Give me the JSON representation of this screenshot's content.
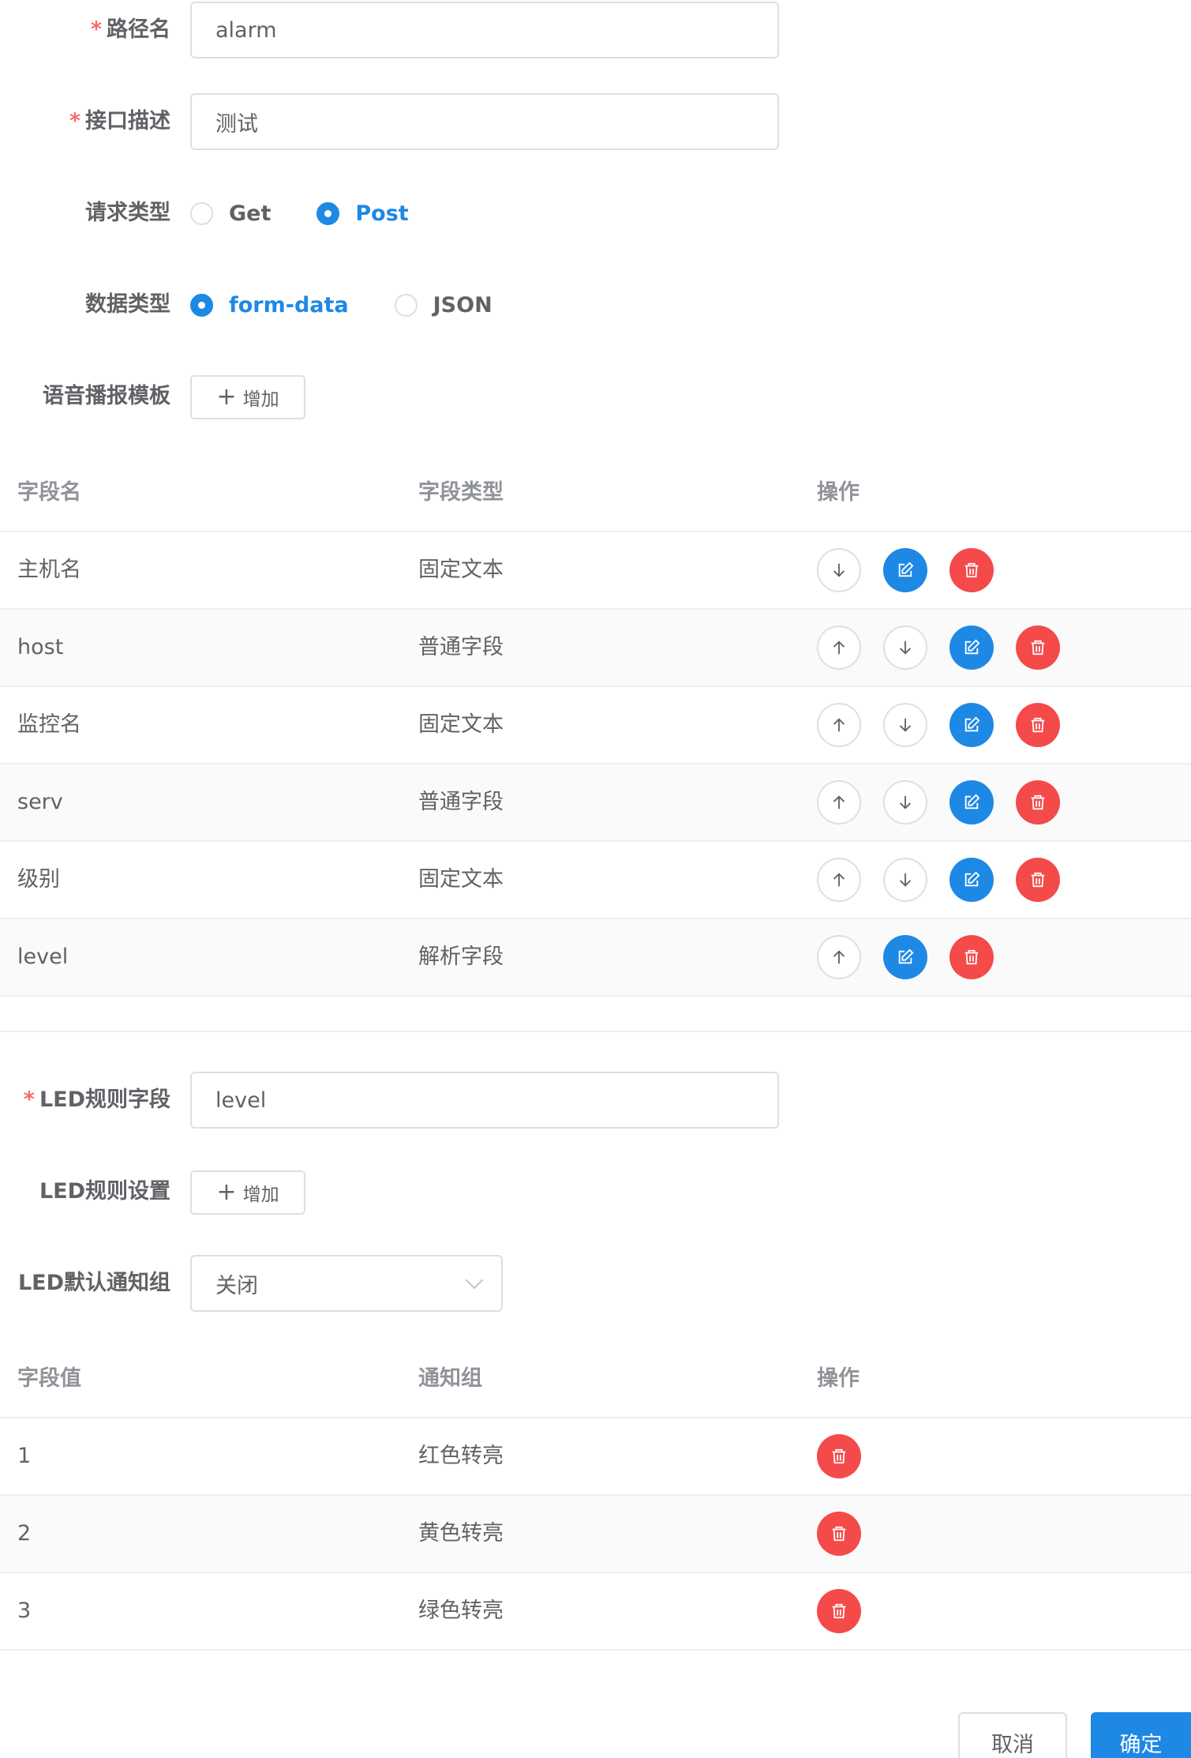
{
  "form": {
    "path_name": {
      "label": "路径名",
      "value": "alarm"
    },
    "interface_desc": {
      "label": "接口描述",
      "value": "测试"
    },
    "request_type": {
      "label": "请求类型",
      "options": [
        "Get",
        "Post"
      ],
      "selected": "Post"
    },
    "data_type": {
      "label": "数据类型",
      "options": [
        "form-data",
        "JSON"
      ],
      "selected": "form-data"
    },
    "voice_template": {
      "label": "语音播报模板",
      "add_label": "增加"
    },
    "led_rule_field": {
      "label": "LED规则字段",
      "value": "level"
    },
    "led_rule_settings": {
      "label": "LED规则设置",
      "add_label": "增加"
    },
    "led_default_group": {
      "label": "LED默认通知组",
      "value": "关闭"
    }
  },
  "fields_table": {
    "headers": [
      "字段名",
      "字段类型",
      "操作"
    ],
    "rows": [
      {
        "name": "主机名",
        "type": "固定文本"
      },
      {
        "name": "host",
        "type": "普通字段"
      },
      {
        "name": "监控名",
        "type": "固定文本"
      },
      {
        "name": "serv",
        "type": "普通字段"
      },
      {
        "name": "级别",
        "type": "固定文本"
      },
      {
        "name": "level",
        "type": "解析字段"
      }
    ]
  },
  "led_table": {
    "headers": [
      "字段值",
      "通知组",
      "操作"
    ],
    "rows": [
      {
        "value": "1",
        "group": "红色转亮"
      },
      {
        "value": "2",
        "group": "黄色转亮"
      },
      {
        "value": "3",
        "group": "绿色转亮"
      }
    ]
  },
  "footer": {
    "cancel_label": "取消",
    "confirm_label": "确定"
  },
  "colors": {
    "primary": "#1e88e5",
    "danger": "#f44a4a",
    "required": "#f56c6c",
    "border": "#dcdfe6"
  },
  "icons": {
    "up": "arrow-up-icon",
    "down": "arrow-down-icon",
    "edit": "edit-icon",
    "delete": "trash-icon",
    "select": "chevron-down-icon"
  }
}
